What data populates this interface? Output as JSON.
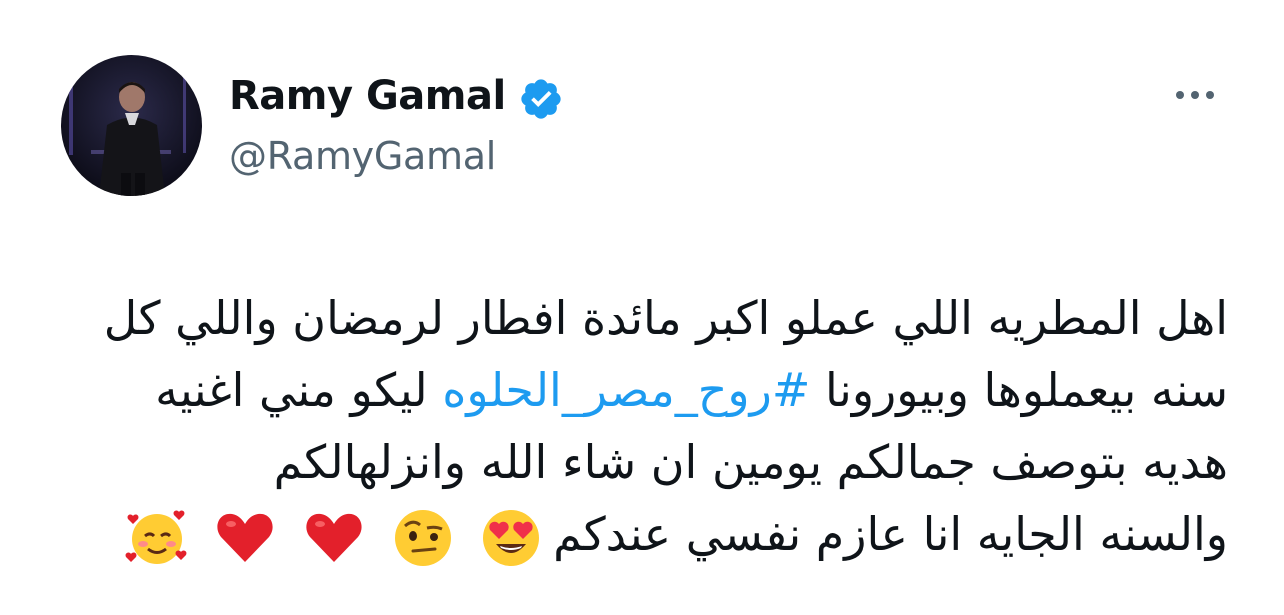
{
  "author": {
    "name": "Ramy Gamal",
    "handle": "@RamyGamal",
    "verified": true,
    "verified_color": "#1d9bf0"
  },
  "more_icon": "more-horizontal-icon",
  "tweet": {
    "line1": "اهل المطريه اللي عملو اكبر مائدة افطار لرمضان واللي كل",
    "line2_before": "سنه بيعملوها وبيورونا ",
    "hashtag": "#روح_مصر_الحلوه",
    "line2_after": " ليكو مني اغنيه",
    "line3": "هديه بتوصف جمالكم يومين ان شاء الله وانزلهالكم",
    "line4": "والسنه الجايه انا عازم نفسي عندكم",
    "emojis": [
      "heart-eyes-emoji",
      "raised-eyebrow-emoji",
      "red-heart-emoji",
      "red-heart-emoji",
      "smiling-face-with-hearts-emoji"
    ]
  },
  "colors": {
    "text": "#0f1419",
    "secondary": "#536471",
    "link": "#1d9bf0"
  }
}
